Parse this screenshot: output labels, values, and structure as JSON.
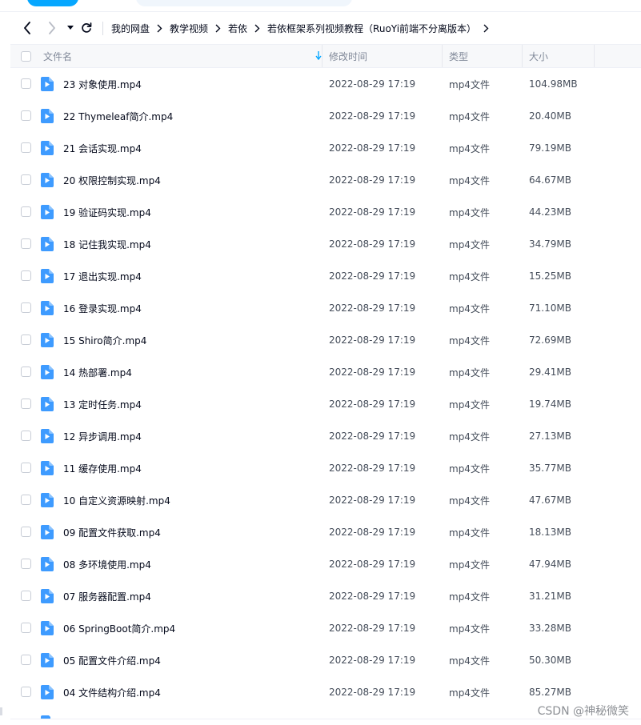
{
  "breadcrumb": [
    "我的网盘",
    "教学视频",
    "若依",
    "若依框架系列视频教程（RuoYi前端不分离版本）"
  ],
  "columns": {
    "name": "文件名",
    "mtime": "修改时间",
    "type": "类型",
    "size": "大小"
  },
  "files": [
    {
      "name": "23 对象使用.mp4",
      "mtime": "2022-08-29 17:19",
      "type": "mp4文件",
      "size": "104.98MB"
    },
    {
      "name": "22 Thymeleaf简介.mp4",
      "mtime": "2022-08-29 17:19",
      "type": "mp4文件",
      "size": "20.40MB"
    },
    {
      "name": "21 会话实现.mp4",
      "mtime": "2022-08-29 17:19",
      "type": "mp4文件",
      "size": "79.19MB"
    },
    {
      "name": "20 权限控制实现.mp4",
      "mtime": "2022-08-29 17:19",
      "type": "mp4文件",
      "size": "64.67MB"
    },
    {
      "name": "19 验证码实现.mp4",
      "mtime": "2022-08-29 17:19",
      "type": "mp4文件",
      "size": "44.23MB"
    },
    {
      "name": "18 记住我实现.mp4",
      "mtime": "2022-08-29 17:19",
      "type": "mp4文件",
      "size": "34.79MB"
    },
    {
      "name": "17 退出实现.mp4",
      "mtime": "2022-08-29 17:19",
      "type": "mp4文件",
      "size": "15.25MB"
    },
    {
      "name": "16 登录实现.mp4",
      "mtime": "2022-08-29 17:19",
      "type": "mp4文件",
      "size": "71.10MB"
    },
    {
      "name": "15 Shiro简介.mp4",
      "mtime": "2022-08-29 17:19",
      "type": "mp4文件",
      "size": "72.69MB"
    },
    {
      "name": "14 热部署.mp4",
      "mtime": "2022-08-29 17:19",
      "type": "mp4文件",
      "size": "29.41MB"
    },
    {
      "name": "13 定时任务.mp4",
      "mtime": "2022-08-29 17:19",
      "type": "mp4文件",
      "size": "19.74MB"
    },
    {
      "name": "12 异步调用.mp4",
      "mtime": "2022-08-29 17:19",
      "type": "mp4文件",
      "size": "27.13MB"
    },
    {
      "name": "11 缓存使用.mp4",
      "mtime": "2022-08-29 17:19",
      "type": "mp4文件",
      "size": "35.77MB"
    },
    {
      "name": "10 自定义资源映射.mp4",
      "mtime": "2022-08-29 17:19",
      "type": "mp4文件",
      "size": "47.67MB"
    },
    {
      "name": "09 配置文件获取.mp4",
      "mtime": "2022-08-29 17:19",
      "type": "mp4文件",
      "size": "18.13MB"
    },
    {
      "name": "08 多环境使用.mp4",
      "mtime": "2022-08-29 17:19",
      "type": "mp4文件",
      "size": "47.94MB"
    },
    {
      "name": "07 服务器配置.mp4",
      "mtime": "2022-08-29 17:19",
      "type": "mp4文件",
      "size": "31.21MB"
    },
    {
      "name": "06 SpringBoot简介.mp4",
      "mtime": "2022-08-29 17:19",
      "type": "mp4文件",
      "size": "33.28MB"
    },
    {
      "name": "05 配置文件介绍.mp4",
      "mtime": "2022-08-29 17:19",
      "type": "mp4文件",
      "size": "50.30MB"
    },
    {
      "name": "04 文件结构介绍.mp4",
      "mtime": "2022-08-29 17:19",
      "type": "mp4文件",
      "size": "85.27MB"
    }
  ],
  "watermark": "CSDN @神秘微笑",
  "colors": {
    "accent": "#06a7ff",
    "file_icon": "#3e9bff",
    "sort_arrow": "#06a7ff"
  },
  "icons": [
    "back-arrow-icon",
    "forward-arrow-icon",
    "dropdown-caret-icon",
    "refresh-icon",
    "chevron-right-icon",
    "sort-down-icon",
    "video-file-icon"
  ]
}
